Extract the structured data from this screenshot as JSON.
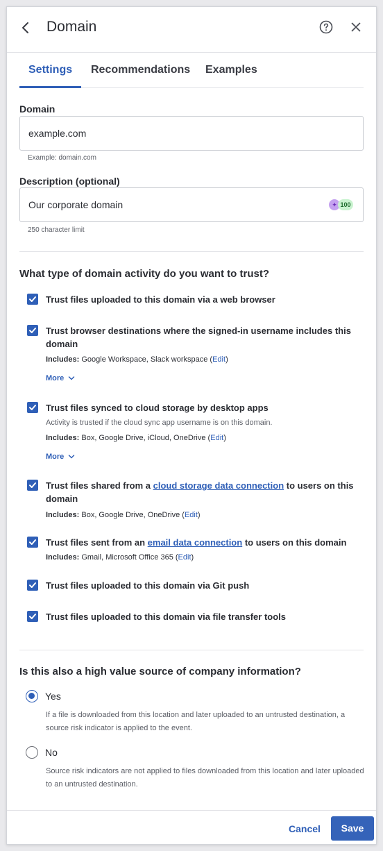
{
  "header": {
    "title": "Domain"
  },
  "tabs": [
    {
      "label": "Settings"
    },
    {
      "label": "Recommendations"
    },
    {
      "label": "Examples"
    }
  ],
  "form": {
    "domain_label": "Domain",
    "domain_value": "example.com",
    "domain_helper": "Example: domain.com",
    "description_label": "Description (optional)",
    "description_value": "Our corporate domain",
    "description_badge_count": "100",
    "description_helper": "250 character limit"
  },
  "trust": {
    "title": "What type of domain activity do you want to trust?",
    "options": [
      {
        "text": "Trust files uploaded to this domain via a web browser"
      },
      {
        "text": "Trust browser destinations where the signed-in username includes this domain",
        "includes_label": "Includes:",
        "includes_value": "Google Workspace, Slack workspace",
        "edit_label": "Edit",
        "more_label": "More"
      },
      {
        "text": "Trust files synced to cloud storage by desktop apps",
        "note": "Activity is trusted if the cloud sync app username is on this domain.",
        "includes_label": "Includes:",
        "includes_value": "Box, Google Drive, iCloud, OneDrive",
        "edit_label": "Edit",
        "more_label": "More"
      },
      {
        "text_before": "Trust files shared from a ",
        "link": "cloud storage data connection",
        "text_after": " to users on this domain",
        "includes_label": "Includes:",
        "includes_value": "Box, Google Drive, OneDrive",
        "edit_label": "Edit"
      },
      {
        "text_before": "Trust files sent from an ",
        "link": "email data connection",
        "text_after": " to users on this domain",
        "includes_label": "Includes:",
        "includes_value": "Gmail, Microsoft Office 365",
        "edit_label": "Edit"
      },
      {
        "text": "Trust files uploaded to this domain via Git push"
      },
      {
        "text": "Trust files uploaded to this domain via file transfer tools"
      }
    ]
  },
  "high_value": {
    "title": "Is this also a high value source of company information?",
    "yes_label": "Yes",
    "yes_desc": "If a file is downloaded from this location and later uploaded to an untrusted destination, a source risk indicator is applied to the event.",
    "no_label": "No",
    "no_desc": "Source risk indicators are not applied to files downloaded from this location and later uploaded to an untrusted destination."
  },
  "footer": {
    "cancel_label": "Cancel",
    "save_label": "Save"
  },
  "colors": {
    "accent": "#2f5fb7",
    "save_button": "#3563b9"
  },
  "icons": {
    "back": "chevron-left-icon",
    "help": "question-circle-icon",
    "close": "close-icon",
    "check": "checkmark-icon",
    "more": "chevron-down-icon",
    "ai": "sparkle-icon"
  }
}
